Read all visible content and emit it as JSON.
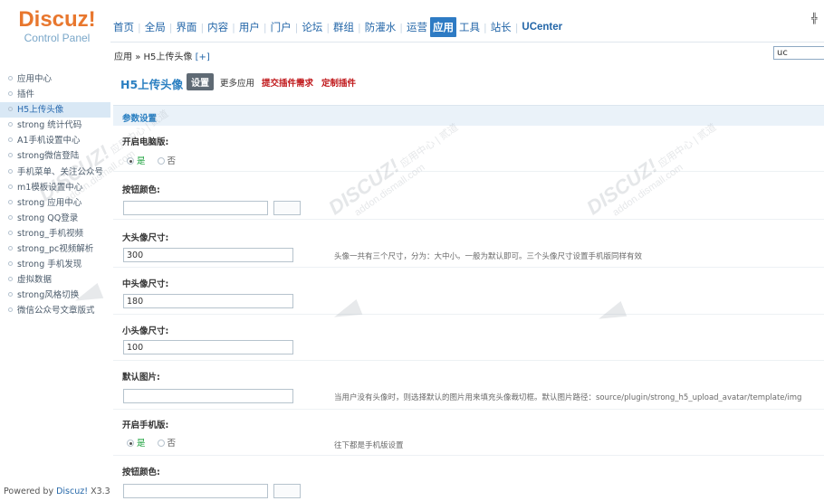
{
  "brand": {
    "name": "Discuz!",
    "subtitle": "Control Panel"
  },
  "corner_mark": "╬",
  "topnav": [
    {
      "label": "首页"
    },
    {
      "label": "全局"
    },
    {
      "label": "界面"
    },
    {
      "label": "内容"
    },
    {
      "label": "用户"
    },
    {
      "label": "门户"
    },
    {
      "label": "论坛"
    },
    {
      "label": "群组"
    },
    {
      "label": "防灌水"
    },
    {
      "label": "运营"
    },
    {
      "label": "应用"
    },
    {
      "label": "工具"
    },
    {
      "label": "站长"
    },
    {
      "label": "UCenter"
    }
  ],
  "breadcrumb": {
    "root": "应用",
    "sep": "»",
    "current": "H5上传头像",
    "plus": "[+]"
  },
  "search": {
    "value": "uc"
  },
  "sidebar": {
    "items": [
      {
        "label": "应用中心"
      },
      {
        "label": "插件"
      },
      {
        "label": "H5上传头像"
      },
      {
        "label": "strong 统计代码"
      },
      {
        "label": "A1手机设置中心"
      },
      {
        "label": "strong微信登陆"
      },
      {
        "label": "手机菜单、关注公众号"
      },
      {
        "label": "m1模板设置中心"
      },
      {
        "label": "strong 应用中心"
      },
      {
        "label": "strong QQ登录"
      },
      {
        "label": "strong_手机视频"
      },
      {
        "label": "strong_pc视频解析"
      },
      {
        "label": "strong 手机发现"
      },
      {
        "label": "虚拟数据"
      },
      {
        "label": "strong风格切换"
      },
      {
        "label": "微信公众号文章版式"
      }
    ],
    "powered_prefix": "Powered by ",
    "powered_brand": "Discuz!",
    "powered_version": " X3.3"
  },
  "main": {
    "title": "H5上传头像",
    "tab_settings": "设置",
    "tab_more": "更多应用",
    "tab_submit": "提交插件需求",
    "tab_custom": "定制插件",
    "section_title": "参数设置",
    "yes": "是",
    "no": "否",
    "fields": {
      "pc_enable_label": "开启电脑版:",
      "button_color_label": "按钮颜色:",
      "large_size_label": "大头像尺寸:",
      "large_size_value": "300",
      "large_size_tip": "头像一共有三个尺寸，分为：大中小。一般为默认即可。三个头像尺寸设置手机版同样有效",
      "medium_size_label": "中头像尺寸:",
      "medium_size_value": "180",
      "small_size_label": "小头像尺寸:",
      "small_size_value": "100",
      "default_img_label": "默认图片:",
      "default_img_tip": "当用户没有头像时，则选择默认的图片用来填充头像裁切框。默认图片路径：source/plugin/strong_h5_upload_avatar/template/img",
      "mobile_enable_label": "开启手机版:",
      "mobile_enable_tip": "往下都是手机版设置",
      "mobile_button_color_label": "按钮颜色:"
    }
  },
  "watermark": {
    "brand": "DISCUZ!",
    "line": "应用中心 | 贰道",
    "domain": "addon.dismall.com"
  }
}
